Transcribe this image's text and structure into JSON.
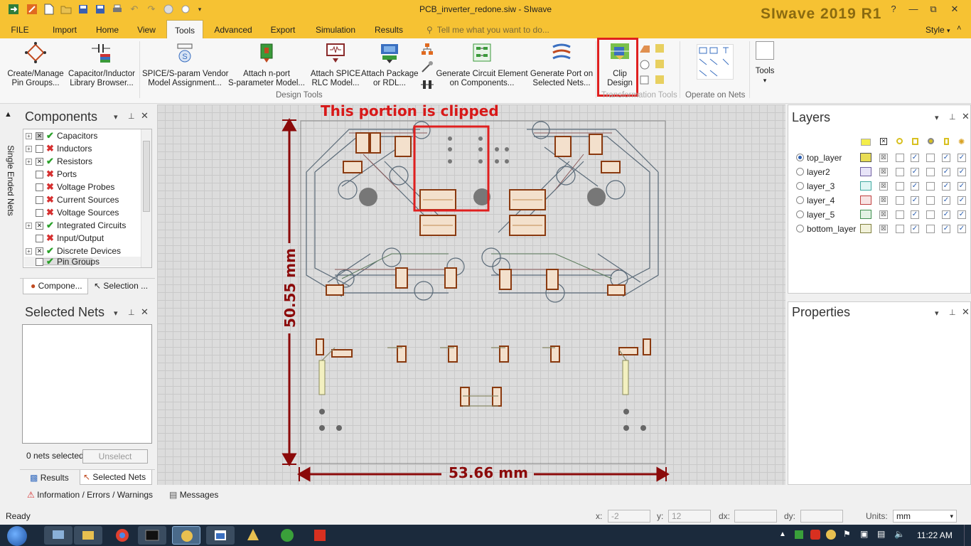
{
  "window": {
    "title": "PCB_inverter_redone.siw - SIwave",
    "brand": "SIwave 2019 R1",
    "controls": [
      "?",
      "—",
      "⧉",
      "✕"
    ]
  },
  "menu": {
    "tabs": [
      "FILE",
      "Import",
      "Home",
      "View",
      "Tools",
      "Advanced",
      "Export",
      "Simulation",
      "Results"
    ],
    "active_tab": "Tools",
    "tell_me": "Tell me what you want to do...",
    "style": "Style"
  },
  "ribbon": {
    "buttons": [
      {
        "line1": "Create/Manage",
        "line2": "Pin Groups..."
      },
      {
        "line1": "Capacitor/Inductor",
        "line2": "Library Browser..."
      },
      {
        "line1": "SPICE/S-param Vendor",
        "line2": "Model Assignment..."
      },
      {
        "line1": "Attach n-port",
        "line2": "S-parameter Model..."
      },
      {
        "line1": "Attach SPICE",
        "line2": "RLC Model..."
      },
      {
        "line1": "Attach Package",
        "line2": "or RDL..."
      },
      {
        "line1": "Generate Circuit Element",
        "line2": "on Components..."
      },
      {
        "line1": "Generate Port on",
        "line2": "Selected Nets..."
      },
      {
        "line1": "Clip",
        "line2": "Design"
      },
      {
        "line1": "Tools",
        "line2": "▾"
      }
    ],
    "groups": [
      "Design Tools",
      "Transformation Tools",
      "Operate on Nets"
    ]
  },
  "components_panel": {
    "title": "Components",
    "side_tab": "Single Ended Nets",
    "items": [
      {
        "label": "Capacitors",
        "status": "ok"
      },
      {
        "label": "Inductors",
        "status": "no"
      },
      {
        "label": "Resistors",
        "status": "ok"
      },
      {
        "label": "Ports",
        "status": "no"
      },
      {
        "label": "Voltage Probes",
        "status": "no"
      },
      {
        "label": "Current Sources",
        "status": "no"
      },
      {
        "label": "Voltage Sources",
        "status": "no"
      },
      {
        "label": "Integrated Circuits",
        "status": "ok"
      },
      {
        "label": "Input/Output",
        "status": "no"
      },
      {
        "label": "Discrete Devices",
        "status": "ok"
      },
      {
        "label": "Pin Groups",
        "status": "ok"
      }
    ],
    "bottom_tabs": [
      "Compone...",
      "Selection ..."
    ]
  },
  "selected_nets": {
    "title": "Selected Nets",
    "count_text": "0 nets selected",
    "unselect": "Unselect",
    "bottom_tabs": [
      "Results",
      "Selected Nets"
    ]
  },
  "canvas": {
    "annotation": "This portion is clipped",
    "dim_vertical": "50.55 mm",
    "dim_horizontal": "53.66 mm"
  },
  "layers": {
    "title": "Layers",
    "rows": [
      {
        "name": "top_layer",
        "color": "#e8dd55",
        "active": true
      },
      {
        "name": "layer2",
        "color": "#9b8fd1",
        "active": false
      },
      {
        "name": "layer_3",
        "color": "#7fd6d0",
        "active": false
      },
      {
        "name": "layer_4",
        "color": "#e08a8a",
        "active": false
      },
      {
        "name": "layer_5",
        "color": "#7fbf8a",
        "active": false
      },
      {
        "name": "bottom_layer",
        "color": "#d8d59a",
        "active": false
      }
    ]
  },
  "properties": {
    "title": "Properties"
  },
  "message_tabs": [
    "Information / Errors / Warnings",
    "Messages"
  ],
  "status": {
    "ready": "Ready",
    "x_label": "x:",
    "x_value": "-2",
    "y_label": "y:",
    "y_value": "12",
    "dx_label": "dx:",
    "dy_label": "dy:",
    "units_label": "Units:",
    "units_value": "mm"
  },
  "taskbar": {
    "clock": "11:22 AM"
  }
}
